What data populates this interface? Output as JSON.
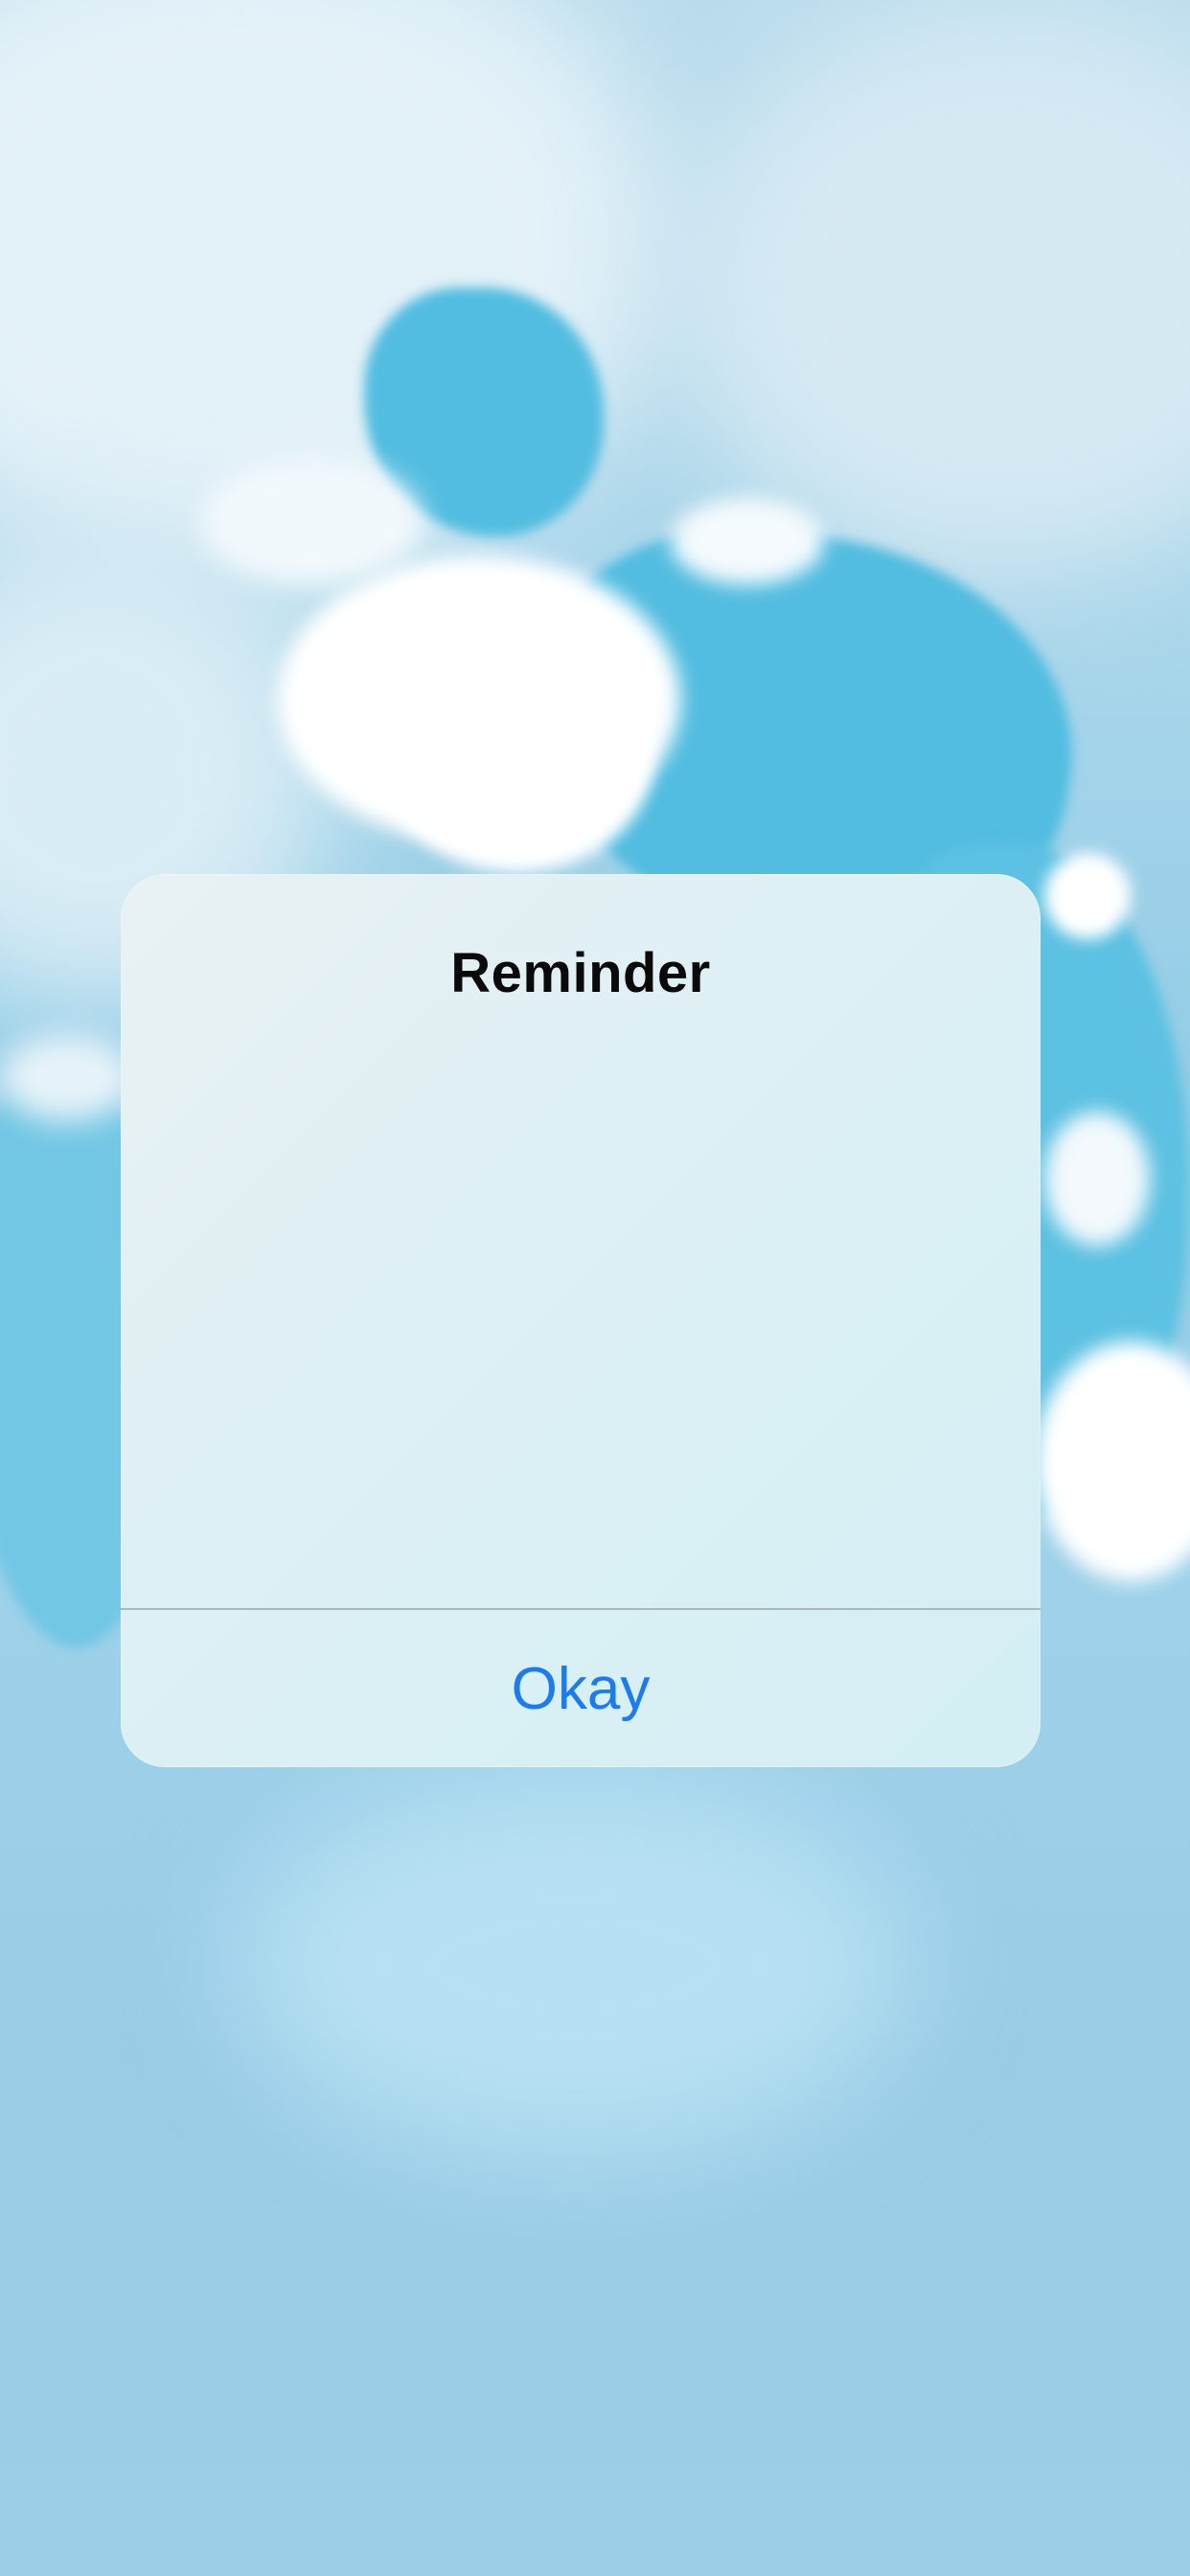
{
  "alert": {
    "title": "Reminder",
    "message": "",
    "actions": [
      {
        "label": "Okay"
      }
    ]
  },
  "colors": {
    "action_text": "#1a7cf0",
    "title_text": "#0a0a0a",
    "divider": "#a9b8be"
  },
  "background": {
    "description_icon": "sky-clouds-wallpaper"
  }
}
